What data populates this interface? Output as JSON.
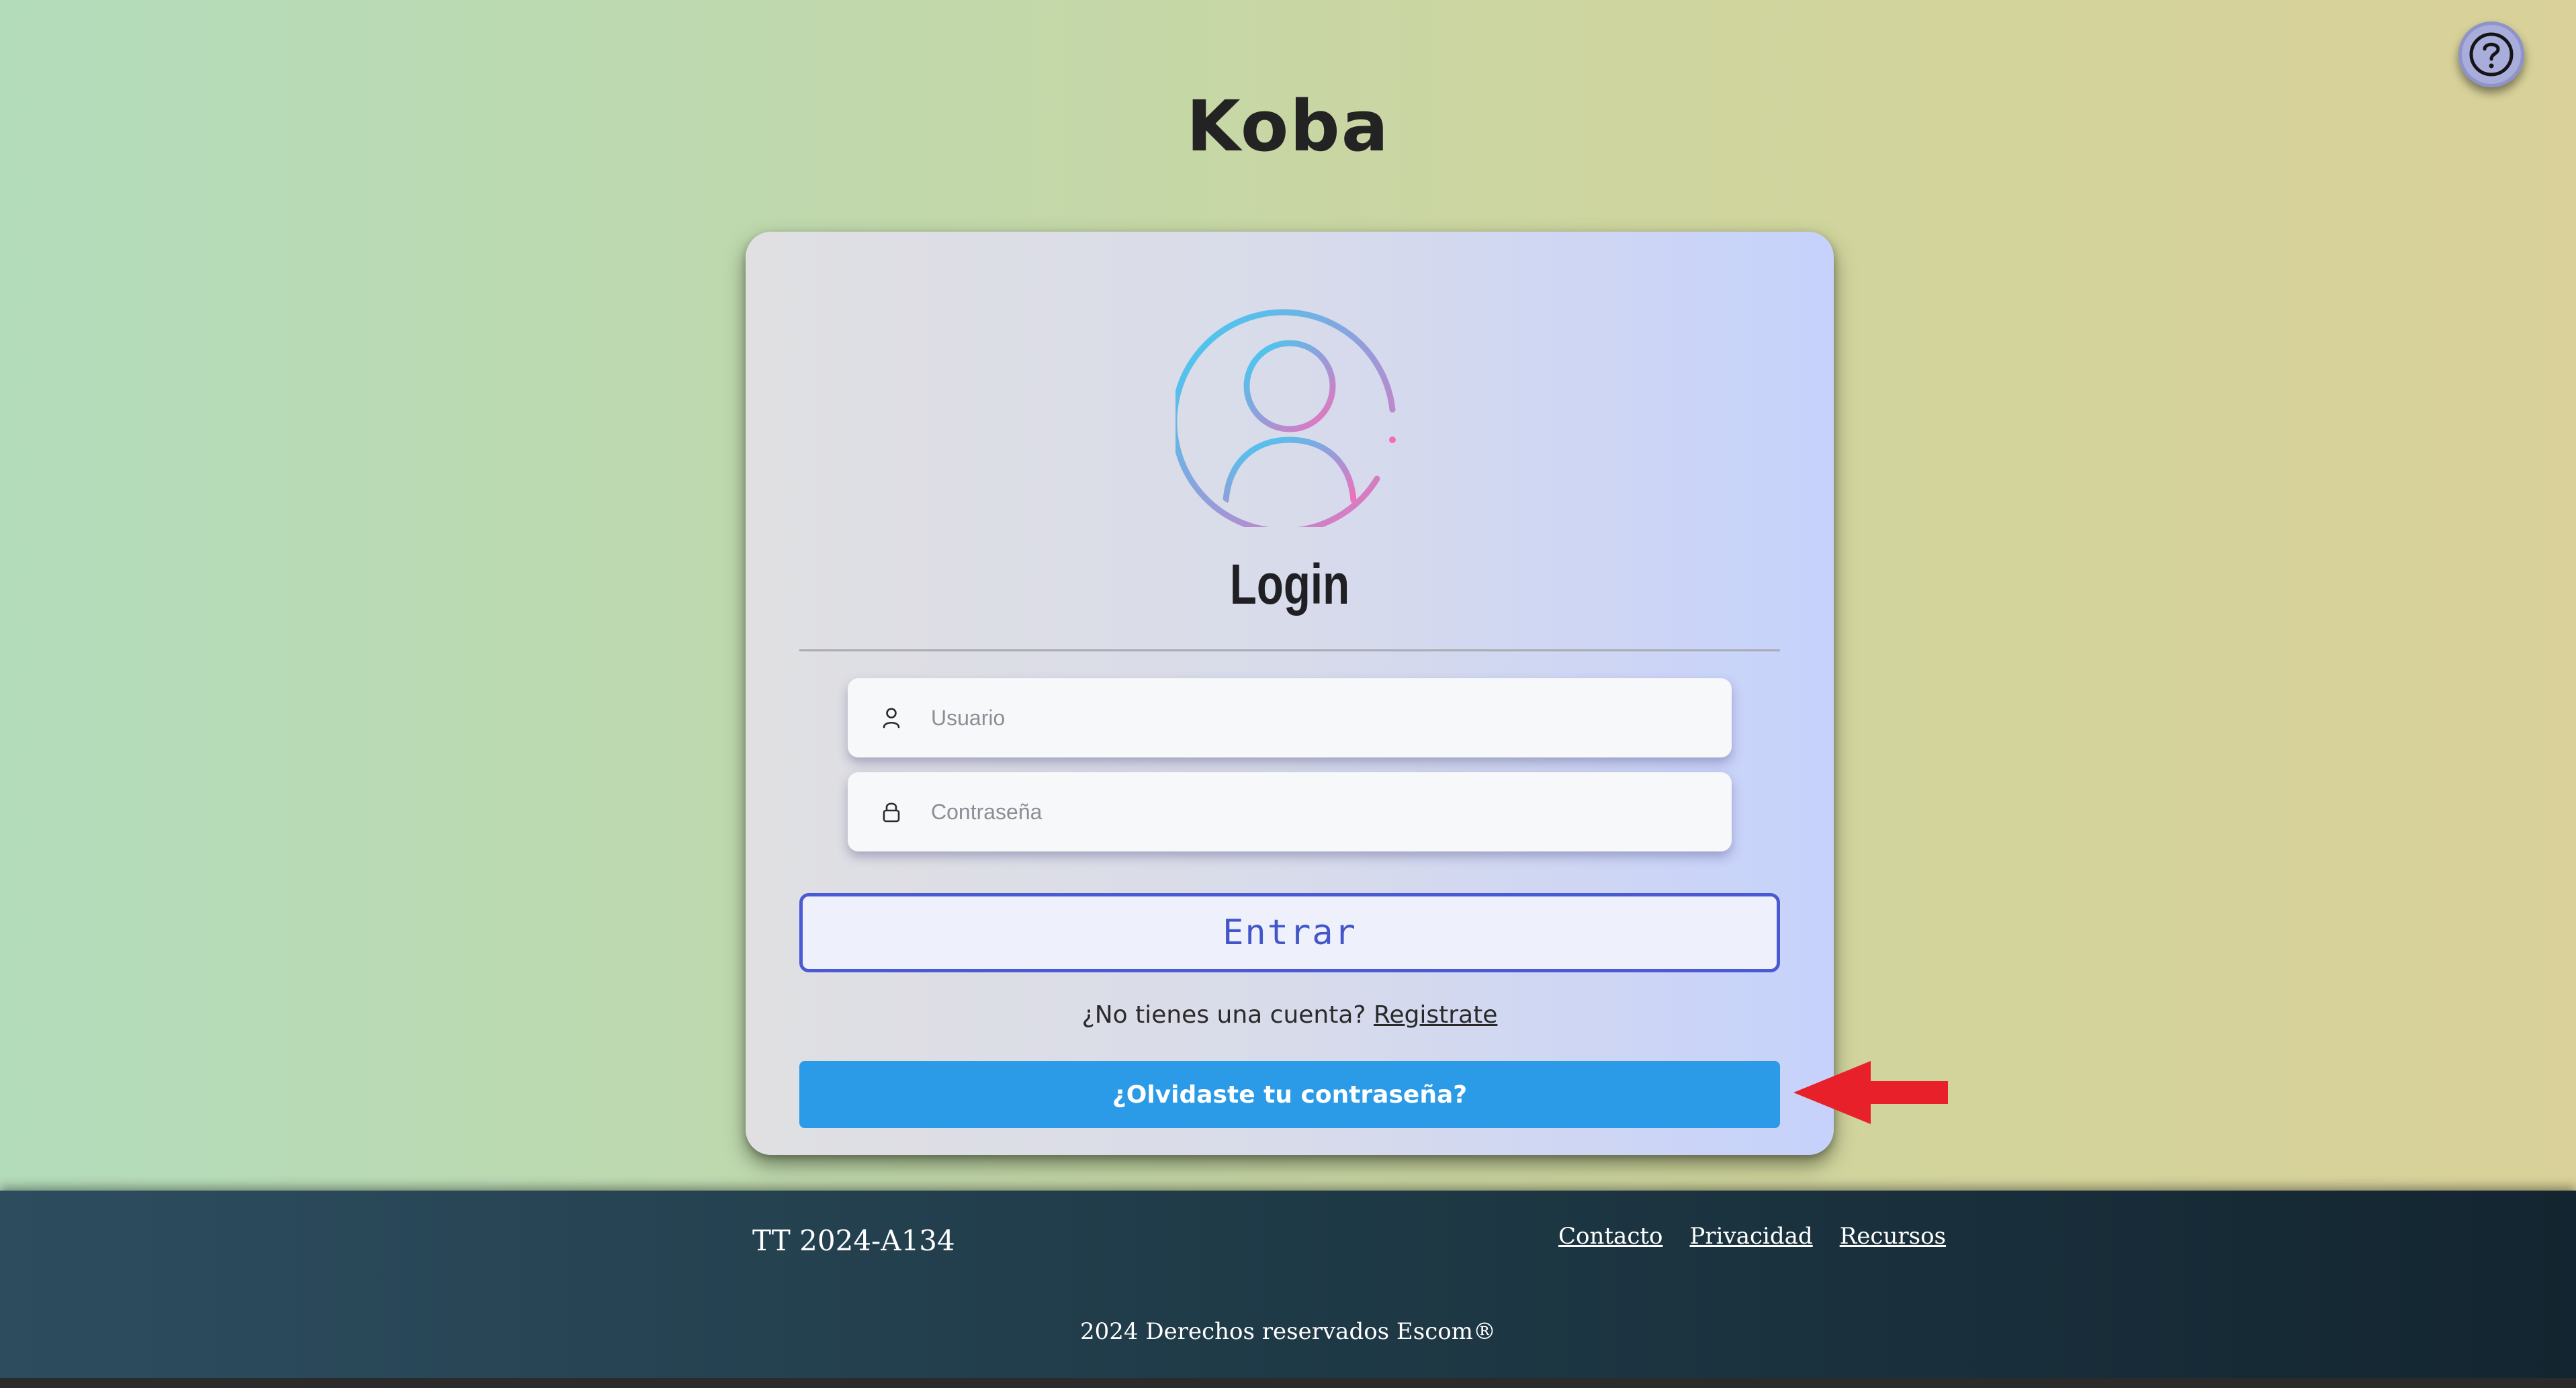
{
  "header": {
    "app_title": "Koba",
    "help_icon": "help-circle-icon"
  },
  "login_card": {
    "avatar_icon": "user-circle-icon",
    "heading": "Login",
    "username": {
      "icon": "user-icon",
      "placeholder": "Usuario",
      "value": ""
    },
    "password": {
      "icon": "lock-icon",
      "placeholder": "Contraseña",
      "value": ""
    },
    "submit_label": "Entrar",
    "register_prompt": "¿No tienes una cuenta?",
    "register_link": "Registrate",
    "forgot_label": "¿Olvidaste tu contraseña?"
  },
  "annotation": {
    "icon": "red-arrow-left-icon",
    "color": "#e8202a"
  },
  "footer": {
    "code": "TT 2024-A134",
    "links": [
      "Contacto",
      "Privacidad",
      "Recursos"
    ],
    "copyright": "2024 Derechos reservados Escom®"
  },
  "colors": {
    "primary_blue": "#2b9be7",
    "entrar_border": "#4a59d4",
    "footer_bg": "#1f3a47"
  }
}
